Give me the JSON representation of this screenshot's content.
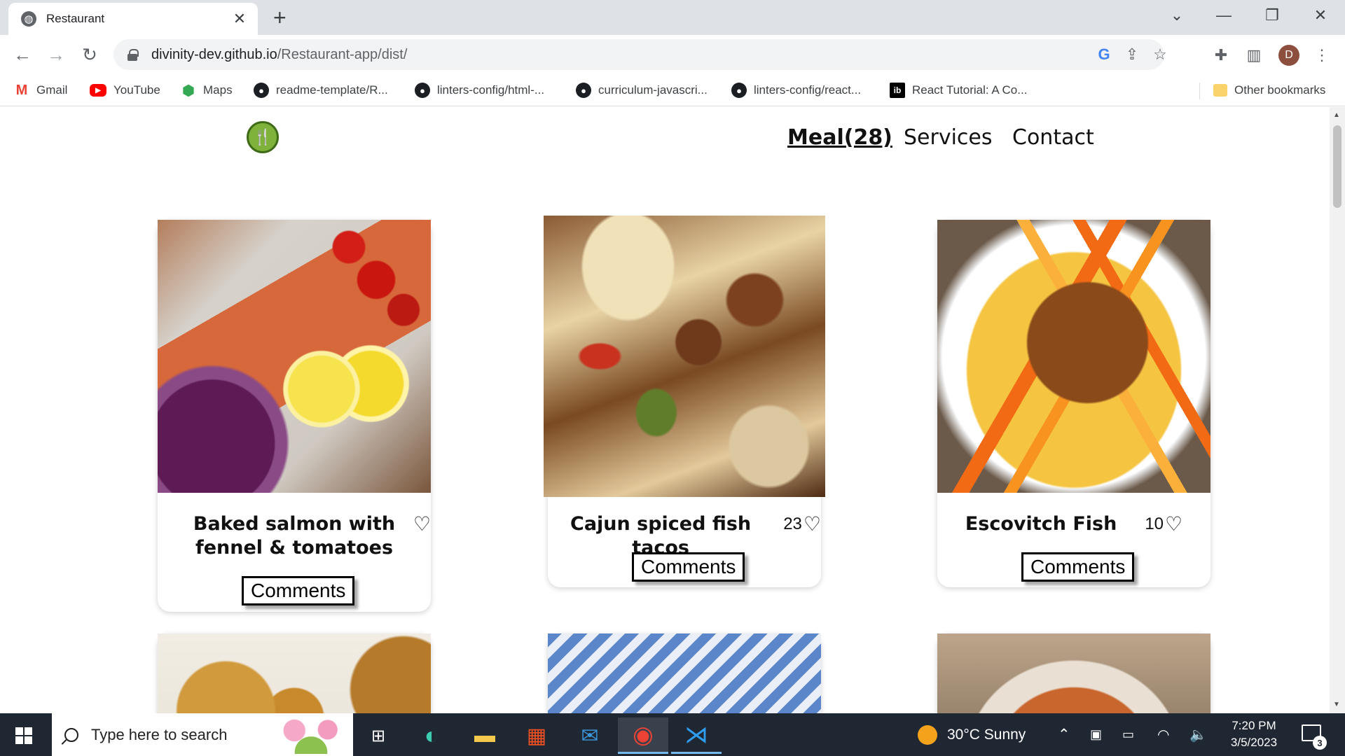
{
  "browser": {
    "tab_title": "Restaurant",
    "tab_close": "✕",
    "new_tab": "+",
    "url_host": "divinity-dev.github.io",
    "url_path": "/Restaurant-app/dist/",
    "profile_initial": "D"
  },
  "bookmarks": [
    {
      "label": "Gmail",
      "icon": "gmail-icon"
    },
    {
      "label": "YouTube",
      "icon": "youtube-icon"
    },
    {
      "label": "Maps",
      "icon": "maps-icon"
    },
    {
      "label": "readme-template/R...",
      "icon": "github-icon"
    },
    {
      "label": "linters-config/html-...",
      "icon": "github-icon"
    },
    {
      "label": "curriculum-javascri...",
      "icon": "github-icon"
    },
    {
      "label": "linters-config/react...",
      "icon": "github-icon"
    },
    {
      "label": "React Tutorial: A Co...",
      "icon": "ib-icon"
    },
    {
      "label": "Other bookmarks",
      "icon": "folder-icon"
    }
  ],
  "site": {
    "nav": {
      "meals": "Meal(28)",
      "services": "Services",
      "contact": "Contact"
    },
    "meals": [
      {
        "name": "Baked salmon with fennel & tomatoes",
        "likes": "",
        "comments_label": "Comments"
      },
      {
        "name": "Cajun spiced fish tacos",
        "likes": "23",
        "comments_label": "Comments"
      },
      {
        "name": "Escovitch Fish",
        "likes": "10",
        "comments_label": "Comments"
      }
    ]
  },
  "taskbar": {
    "search_placeholder": "Type here to search",
    "weather": "30°C  Sunny",
    "time": "7:20 PM",
    "date": "3/5/2023",
    "notification_count": "3"
  },
  "colors": {
    "accent_blue": "#76b9ed",
    "taskbar_bg": "#1f2733",
    "chrome_tabstrip": "#dee1e6"
  }
}
